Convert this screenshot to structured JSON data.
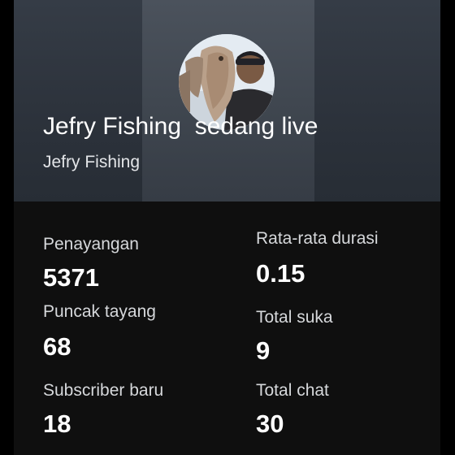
{
  "header": {
    "title": "Jefry Fishing  sedang live",
    "channel": "Jefry Fishing",
    "avatar_icon": "channel-avatar-photo"
  },
  "stats": {
    "views": {
      "label": "Penayangan",
      "value": "5371"
    },
    "avg_duration": {
      "label": "Rata-rata durasi",
      "value": "0.15"
    },
    "peak_viewers": {
      "label": "Puncak tayang",
      "value": "68"
    },
    "total_likes": {
      "label": "Total suka",
      "value": "9"
    },
    "new_subscribers": {
      "label": "Subscriber baru",
      "value": "18"
    },
    "total_chat": {
      "label": "Total chat",
      "value": "30"
    }
  },
  "colors": {
    "header_bg": "#2b3139",
    "header_center_bg": "#444b55",
    "stats_bg": "#0f0f0f",
    "text": "#ffffff",
    "label_text": "#d6d8db"
  }
}
